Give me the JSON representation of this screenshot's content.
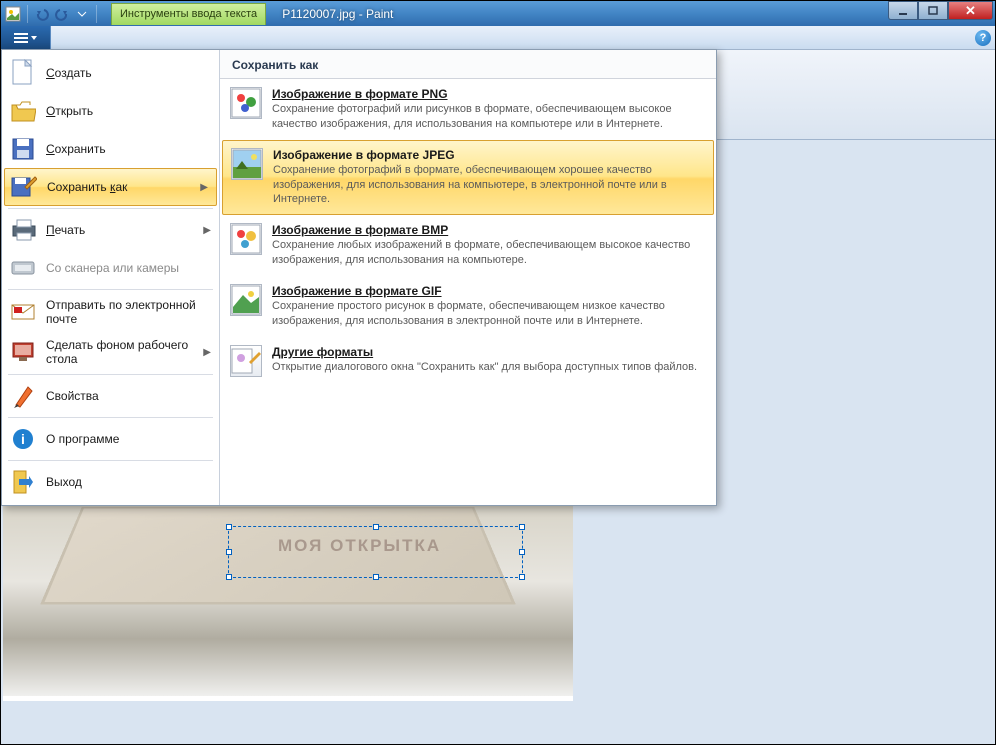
{
  "window": {
    "title": "P1120007.jpg - Paint",
    "text_tools_tab": "Инструменты ввода текста"
  },
  "canvas": {
    "overlay_text": "МОЯ ОТКРЫТКА"
  },
  "file_menu": {
    "items": [
      {
        "label": "Создать",
        "icon": "new",
        "first_ul": true
      },
      {
        "label": "Открыть",
        "icon": "open",
        "first_ul": true
      },
      {
        "label": "Сохранить",
        "icon": "save",
        "first_ul": true
      },
      {
        "label_pre": "Сохранить ",
        "label_ul": "к",
        "label_post": "ак",
        "icon": "saveas",
        "arrow": true,
        "selected": true
      },
      {
        "label": "Печать",
        "icon": "print",
        "first_ul": true,
        "arrow": true,
        "sep_before": true
      },
      {
        "label": "Со сканера или камеры",
        "icon": "scanner",
        "disabled": true
      },
      {
        "label": "Отправить по электронной почте",
        "icon": "mail",
        "sep_before": true
      },
      {
        "label": "Сделать фоном рабочего стола",
        "icon": "desktop",
        "arrow": true
      },
      {
        "label": "Свойства",
        "icon": "props",
        "sep_before": true
      },
      {
        "label": "О программе",
        "icon": "about",
        "sep_before": true
      },
      {
        "label": "Выход",
        "icon": "exit",
        "sep_before": true
      }
    ]
  },
  "save_as_panel": {
    "header": "Сохранить как",
    "formats": [
      {
        "title": "Изображение в формате PNG",
        "desc": "Сохранение фотографий или рисунков в формате, обеспечивающем высокое качество изображения, для использования на компьютере или в Интернете.",
        "icon": "png"
      },
      {
        "title": "Изображение в формате JPEG",
        "desc": "Сохранение фотографий в формате, обеспечивающем хорошее качество изображения, для использования на компьютере, в электронной почте или в Интернете.",
        "icon": "jpeg",
        "hover": true
      },
      {
        "title": "Изображение в формате BMP",
        "desc": "Сохранение любых изображений в формате, обеспечивающем высокое качество изображения, для использования на компьютере.",
        "icon": "bmp"
      },
      {
        "title": "Изображение в формате GIF",
        "desc": "Сохранение простого рисунок в формате, обеспечивающем низкое качество изображения, для использования в электронной почте или в Интернете.",
        "icon": "gif"
      },
      {
        "title": "Другие форматы",
        "desc": "Открытие диалогового окна \"Сохранить как\" для выбора доступных типов файлов.",
        "icon": "other"
      }
    ]
  }
}
